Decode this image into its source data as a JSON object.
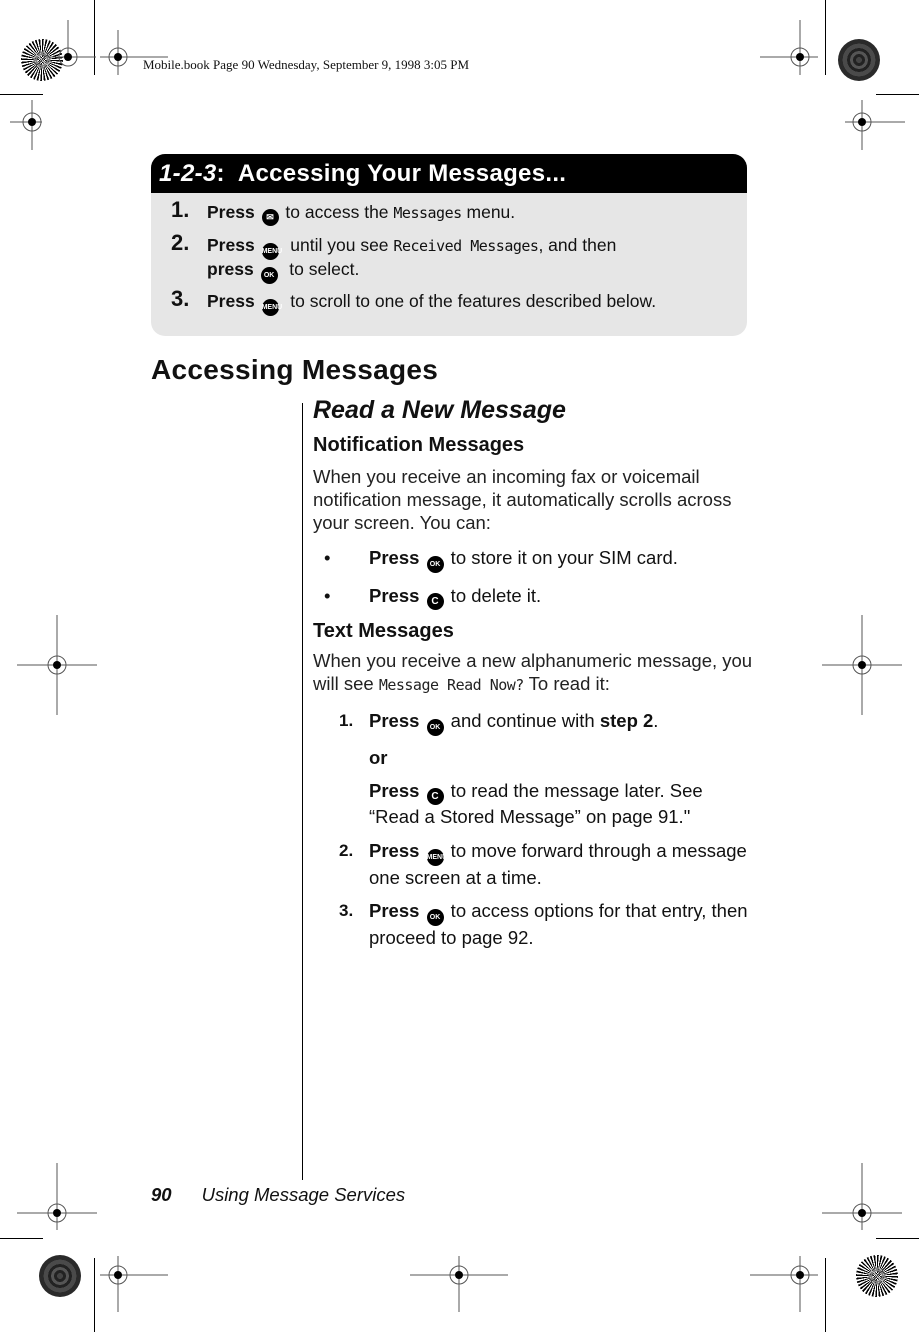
{
  "print_header": "Mobile.book  Page 90  Wednesday, September 9, 1998  3:05 PM",
  "quick_box": {
    "title_prefix": "1-2-3",
    "title_rest": ":  Accessing Your Messages...",
    "steps": [
      {
        "num": "1.",
        "press": "Press",
        "key": "message-key",
        "key_label": "✉",
        "after_key": " to access the ",
        "display": "Messages",
        "after_display": " menu."
      },
      {
        "num": "2.",
        "press": "Press",
        "key": "menu-key",
        "key_label": "MENU",
        "after_key": "  until you see ",
        "display": "Received Messages",
        "after_display": ", and then",
        "line2_press": "press",
        "line2_key": "ok-key",
        "line2_key_label": "OK",
        "line2_rest": "  to select."
      },
      {
        "num": "3.",
        "press": "Press",
        "key": "menu-key",
        "key_label": "MENU",
        "after_key": "  to scroll to one of the features described below."
      }
    ]
  },
  "section_title": "Accessing Messages",
  "subsection_title": "Read a New Message",
  "notification": {
    "heading": "Notification Messages",
    "body": "When you receive an incoming fax or voicemail notification message, it automatically scrolls across your screen. You can:",
    "bullets": [
      {
        "press": "Press",
        "key_label": "OK",
        "text": " to store it on your SIM card."
      },
      {
        "press": "Press",
        "key_label": "C",
        "text": " to delete it."
      }
    ]
  },
  "text_messages": {
    "heading": "Text Messages",
    "body_pre": "When you receive a new alphanumeric message, you will see ",
    "display": "Message Read Now?",
    "body_post": " To read it:",
    "steps": [
      {
        "num": "1.",
        "press": "Press",
        "key_label": "OK",
        "text": " and continue with ",
        "bold_tail": "step 2",
        "end": "."
      },
      {
        "or": "or"
      },
      {
        "press": "Press",
        "key_label": "C",
        "text": " to read the message later. See “Read a Stored Message” on page 91.\""
      },
      {
        "num": "2.",
        "press": "Press",
        "key_label": "MENU",
        "text": "  to move forward through a message one screen at a time."
      },
      {
        "num": "3.",
        "press": "Press",
        "key_label": "OK",
        "text": " to access options for that entry, then proceed to page 92."
      }
    ]
  },
  "footer": {
    "page_number": "90",
    "chapter": "Using Message Services"
  }
}
